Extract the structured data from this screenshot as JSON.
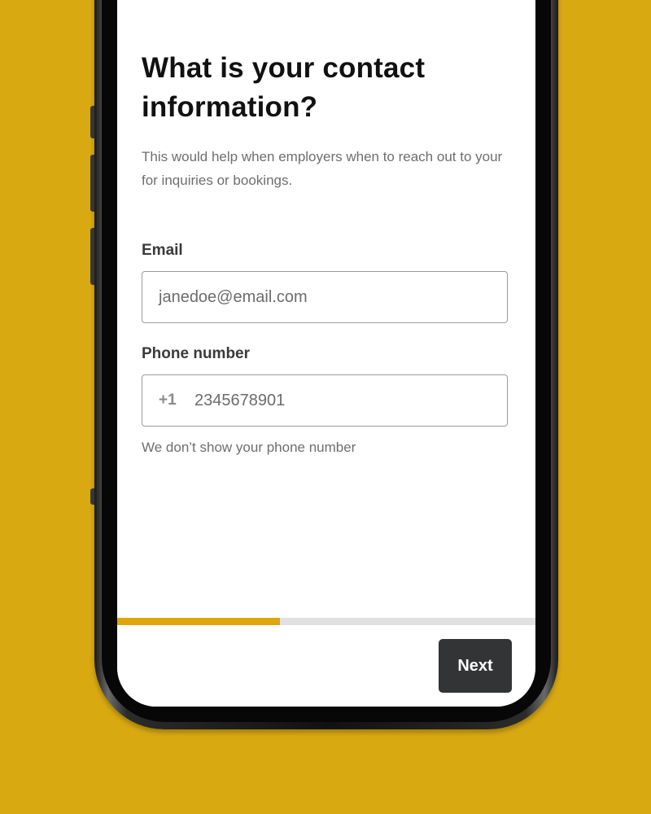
{
  "theme": {
    "background": "#d9a912",
    "accent": "#e0a50c",
    "button": "#333436"
  },
  "form": {
    "title": "What is your contact information?",
    "subtitle": "This would help when employers when to reach out to your for inquiries or bookings.",
    "email": {
      "label": "Email",
      "placeholder": "janedoe@email.com"
    },
    "phone": {
      "label": "Phone number",
      "country_code": "+1",
      "placeholder": "2345678901",
      "hint": "We don’t show your phone number"
    }
  },
  "progress": {
    "fraction": 0.39
  },
  "footer": {
    "next_label": "Next"
  }
}
